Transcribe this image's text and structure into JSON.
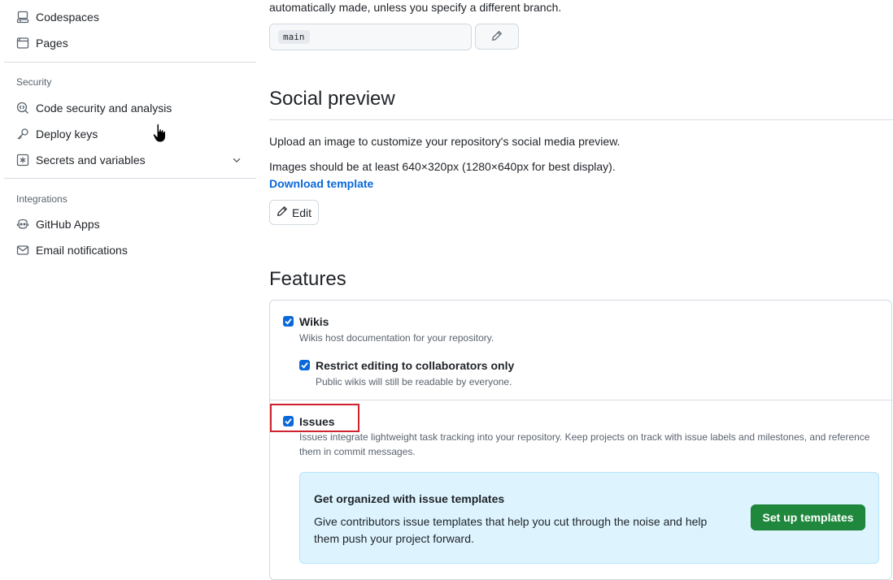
{
  "sidebar": {
    "items_top": [
      {
        "label": "Codespaces",
        "icon": "codespaces-icon"
      },
      {
        "label": "Pages",
        "icon": "browser-icon"
      }
    ],
    "security_group": "Security",
    "security_items": [
      {
        "label": "Code security and analysis",
        "icon": "codescan-icon"
      },
      {
        "label": "Deploy keys",
        "icon": "key-icon"
      },
      {
        "label": "Secrets and variables",
        "icon": "asterisk-icon"
      }
    ],
    "integrations_group": "Integrations",
    "integrations_items": [
      {
        "label": "GitHub Apps",
        "icon": "apps-icon"
      },
      {
        "label": "Email notifications",
        "icon": "mail-icon"
      }
    ]
  },
  "default_branch": {
    "text": "automatically made, unless you specify a different branch.",
    "value": "main"
  },
  "social_preview": {
    "title": "Social preview",
    "desc1": "Upload an image to customize your repository's social media preview.",
    "desc2": "Images should be at least 640×320px (1280×640px for best display).",
    "download_link": "Download template",
    "edit_label": "Edit"
  },
  "features": {
    "title": "Features",
    "wikis": {
      "label": "Wikis",
      "desc": "Wikis host documentation for your repository.",
      "checked": true
    },
    "restrict": {
      "label": "Restrict editing to collaborators only",
      "desc": "Public wikis will still be readable by everyone.",
      "checked": true
    },
    "issues": {
      "label": "Issues",
      "desc": "Issues integrate lightweight task tracking into your repository. Keep projects on track with issue labels and milestones, and reference them in commit messages.",
      "checked": true
    },
    "promo": {
      "title": "Get organized with issue templates",
      "desc": "Give contributors issue templates that help you cut through the noise and help them push your project forward.",
      "button": "Set up templates"
    }
  },
  "colors": {
    "accent": "#0969da",
    "primary_button": "#1f883d",
    "highlight_border": "#cf222e",
    "promo_bg": "#ddf4ff"
  }
}
